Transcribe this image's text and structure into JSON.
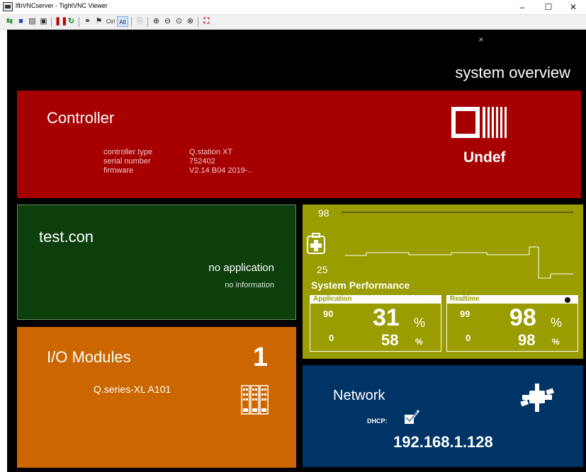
{
  "window": {
    "title": "lfbVNCserver - TightVNC Viewer",
    "minimize": "–",
    "maximize": "☐",
    "close": "✕"
  },
  "toolbar": {
    "ctrl_label": "Ctrl",
    "alt_label": "Alt"
  },
  "screen": {
    "title": "system overview",
    "controller": {
      "title": "Controller",
      "labels": [
        "controller type",
        "serial number",
        "firmware"
      ],
      "values": [
        "Q.station XT",
        "752402",
        "V2.14 B04 2019-.."
      ],
      "status": "Undef"
    },
    "application": {
      "title": "test.con",
      "state": "no application",
      "info": "no information"
    },
    "io": {
      "title": "I/O Modules",
      "count": "1",
      "module": "Q.series-XL A101"
    },
    "performance": {
      "title": "System Performance",
      "graph_top": "98",
      "graph_bottom": "25",
      "application": {
        "label": "Application",
        "hi": "90",
        "lo": "0",
        "value": "31",
        "unit": "%",
        "secondary": "58",
        "secondary_unit": "%"
      },
      "realtime": {
        "label": "Realtime",
        "hi": "99",
        "lo": "0",
        "value": "98",
        "unit": "%",
        "secondary": "98",
        "secondary_unit": "%"
      }
    },
    "network": {
      "title": "Network",
      "dhcp_label": "DHCP:",
      "ip": "192.168.1.128"
    }
  },
  "colors": {
    "controller_bg": "#a60000",
    "application_bg": "#0d3f0d",
    "io_bg": "#cc6600",
    "performance_bg": "#9a9c00",
    "network_bg": "#003366"
  }
}
